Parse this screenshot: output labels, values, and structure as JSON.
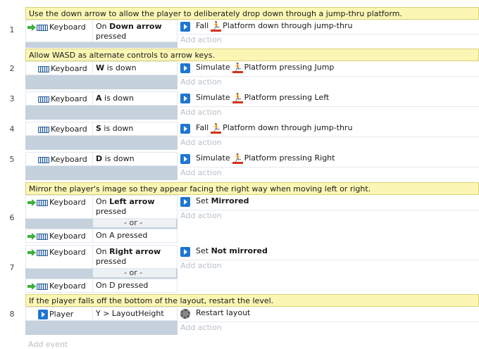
{
  "events": [
    {
      "number": "1",
      "comment": "Use the down arrow to allow the player to deliberately drop down through a jump-thru platform.",
      "conditions": [
        {
          "object": "Keyboard",
          "text_pre": "On ",
          "text_bold": "Down arrow",
          "text_post": "pressed",
          "trigger": true
        }
      ],
      "actions": [
        {
          "verb": "Fall",
          "object": "Platform",
          "text": "down through jump-thru"
        }
      ],
      "add_action": "Add action"
    },
    {
      "number": "2",
      "comment": "Allow WASD as alternate controls to arrow keys.",
      "conditions": [
        {
          "object": "Keyboard",
          "text_bold": "W",
          "text_post": " is down"
        }
      ],
      "actions": [
        {
          "verb": "Simulate",
          "object": "Platform",
          "text": "pressing Jump"
        }
      ],
      "add_action": "Add action"
    },
    {
      "number": "3",
      "conditions": [
        {
          "object": "Keyboard",
          "text_bold": "A",
          "text_post": " is down"
        }
      ],
      "actions": [
        {
          "verb": "Simulate",
          "object": "Platform",
          "text": "pressing Left"
        }
      ],
      "add_action": "Add action"
    },
    {
      "number": "4",
      "conditions": [
        {
          "object": "Keyboard",
          "text_bold": "S",
          "text_post": " is down"
        }
      ],
      "actions": [
        {
          "verb": "Fall",
          "object": "Platform",
          "text": "down through jump-thru"
        }
      ],
      "add_action": "Add action"
    },
    {
      "number": "5",
      "conditions": [
        {
          "object": "Keyboard",
          "text_bold": "D",
          "text_post": " is down"
        }
      ],
      "actions": [
        {
          "verb": "Simulate",
          "object": "Platform",
          "text": "pressing Right"
        }
      ],
      "add_action": "Add action"
    },
    {
      "number": "6",
      "comment": "Mirror the player's image so they appear facing the right way when moving left or right.",
      "conditions": [
        {
          "object": "Keyboard",
          "text_pre": "On ",
          "text_bold": "Left arrow",
          "text_post": "pressed",
          "trigger": true
        },
        {
          "object": "Keyboard",
          "text_pre": "On ",
          "text_bold": "A",
          "text_post": " pressed",
          "trigger": true
        }
      ],
      "or_label": "- or -",
      "actions": [
        {
          "verb": "Set",
          "bold": "Mirrored"
        }
      ],
      "add_action": "Add action"
    },
    {
      "number": "7",
      "conditions": [
        {
          "object": "Keyboard",
          "text_pre": "On ",
          "text_bold": "Right arrow",
          "text_post": "pressed",
          "trigger": true
        },
        {
          "object": "Keyboard",
          "text_pre": "On ",
          "text_bold": "D",
          "text_post": " pressed",
          "trigger": true
        }
      ],
      "or_label": "- or -",
      "actions": [
        {
          "verb": "Set",
          "bold": "Not mirrored"
        }
      ],
      "add_action": "Add action"
    },
    {
      "number": "8",
      "comment": "If the player falls off the bottom of the layout, restart the level.",
      "conditions": [
        {
          "object": "Player",
          "text_post": "Y > LayoutHeight"
        }
      ],
      "actions": [
        {
          "verb": "Restart layout"
        }
      ],
      "add_action": "Add action"
    }
  ],
  "add_event": "Add event",
  "icons": {
    "trigger": "green-arrow-trigger-icon",
    "keyboard": "keyboard-icon",
    "action_object": "blue-arrow-icon",
    "behavior": "platform-behavior-icon",
    "system": "gear-icon",
    "player": "player-sprite-icon"
  },
  "colors": {
    "comment_bg": "#fbf6b4",
    "condition_bg": "#c5d1dc",
    "add_text": "#b9c0c8",
    "accent_blue": "#1e76d0",
    "behavior_red": "#d3341b",
    "trigger_green": "#3db03d"
  }
}
